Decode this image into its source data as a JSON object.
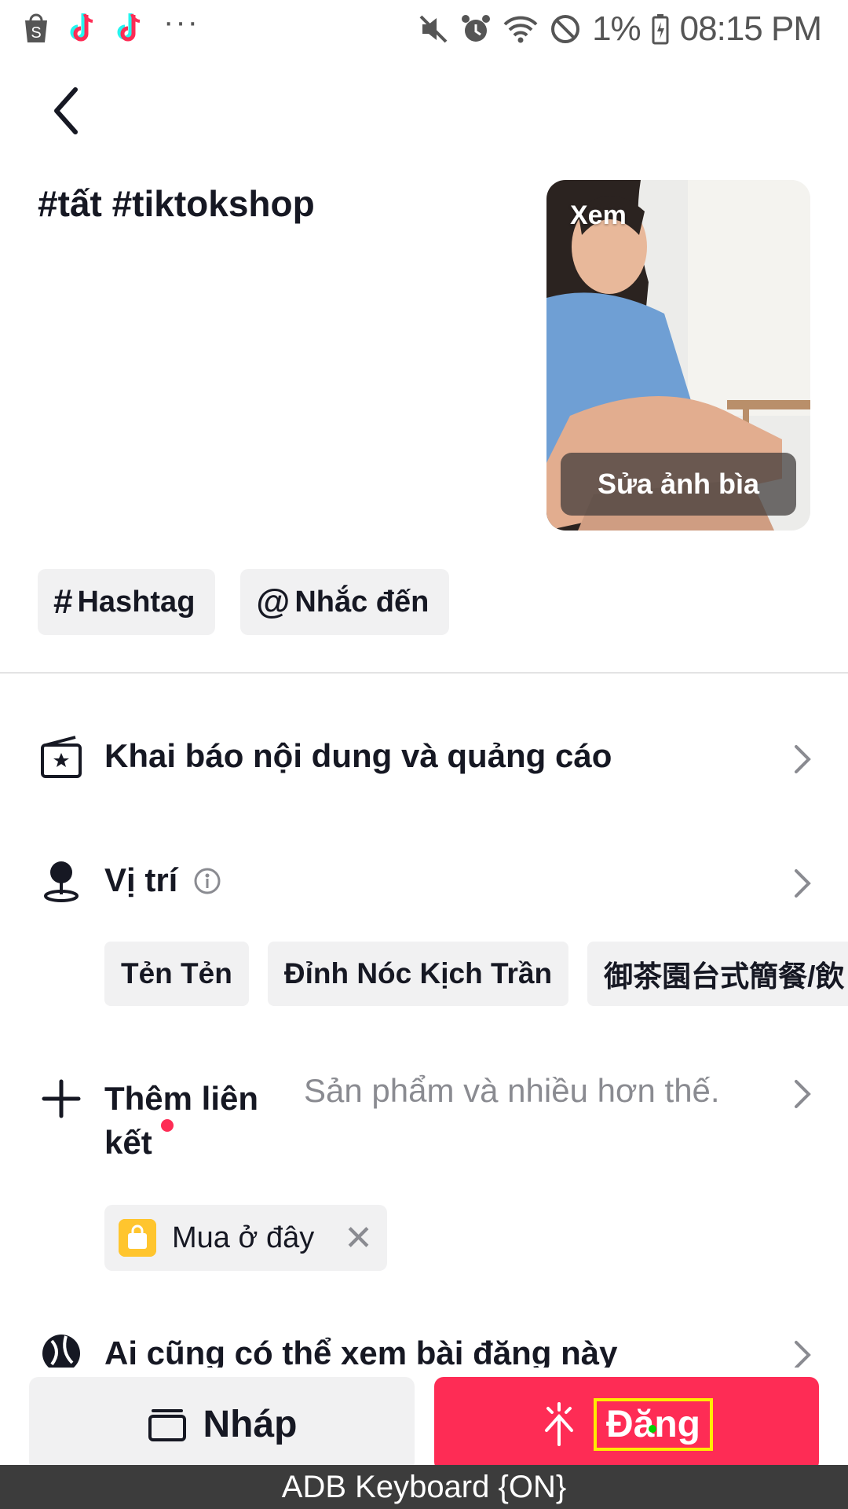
{
  "status_bar": {
    "battery": "1%",
    "time": "08:15 PM",
    "more": "···",
    "icons": [
      "shopee-icon",
      "tiktok-icon",
      "tiktok-icon",
      "mute-icon",
      "alarm-icon",
      "wifi-icon",
      "dnd-icon",
      "battery-icon"
    ]
  },
  "caption": "#tất #tiktokshop",
  "cover": {
    "view_label": "Xem",
    "edit_label": "Sửa ảnh bìa"
  },
  "chips": {
    "hashtag_symbol": "#",
    "hashtag_label": "Hashtag",
    "mention_symbol": "@",
    "mention_label": "Nhắc đến"
  },
  "rows": {
    "disclosure": "Khai báo nội dung và quảng cáo",
    "location": "Vị trí",
    "add_link_line1": "Thêm liên",
    "add_link_line2": "kết",
    "add_link_hint": "Sản phẩm và nhiều hơn thế.",
    "audience": "Ai cũng có thể xem bài đăng này"
  },
  "location_suggestions": [
    "Tẻn Tẻn",
    "Đỉnh Nóc Kịch Trần",
    "御茶園台式簡餐/飲"
  ],
  "shop_link": {
    "label": "Mua ở đây",
    "remove": "✕"
  },
  "buttons": {
    "draft": "Nháp",
    "post": "Đăng"
  },
  "keyboard_banner": "ADB Keyboard {ON}",
  "colors": {
    "accent": "#fe2c55",
    "chip_bg": "#f1f1f2",
    "text": "#161823",
    "hint": "#8a8b91"
  }
}
